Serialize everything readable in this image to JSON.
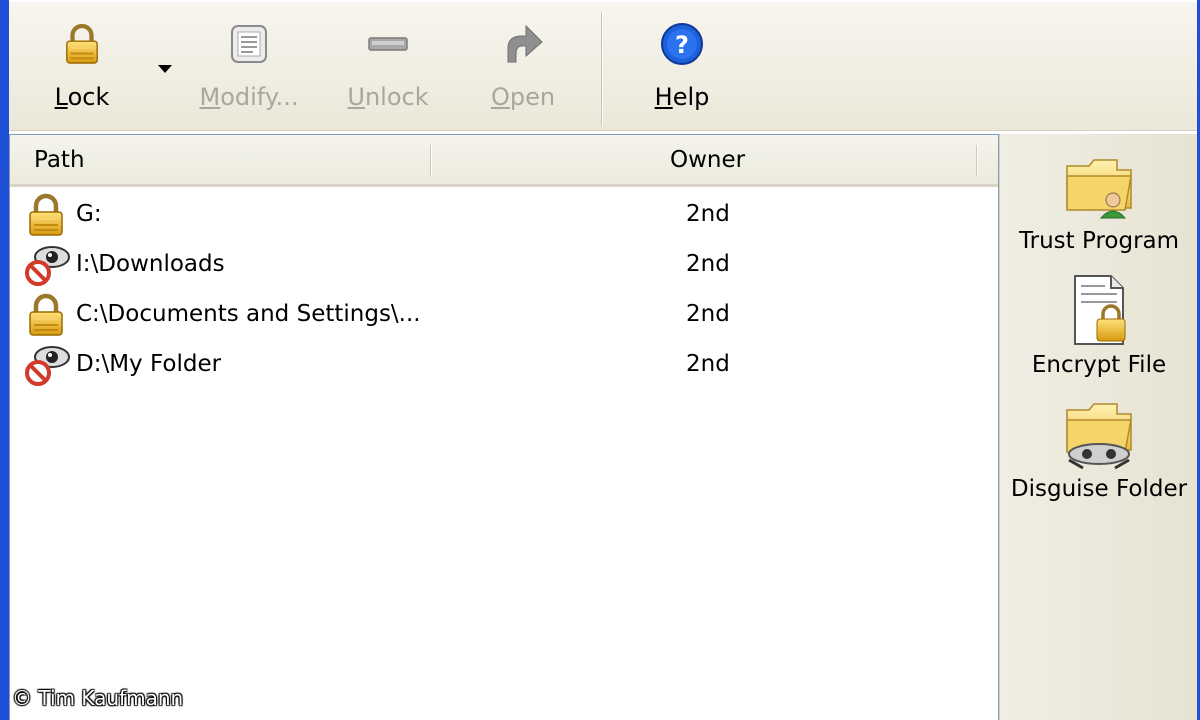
{
  "toolbar": {
    "lock": {
      "label_pre": "",
      "label_key": "L",
      "label_post": "ock",
      "icon": "padlock-icon"
    },
    "modify": {
      "label_pre": "",
      "label_key": "M",
      "label_post": "odify...",
      "icon": "document-icon"
    },
    "unlock": {
      "label_pre": "",
      "label_key": "U",
      "label_post": "nlock",
      "icon": "unlock-icon"
    },
    "open": {
      "label_pre": "",
      "label_key": "O",
      "label_post": "pen",
      "icon": "arrow-icon"
    },
    "help": {
      "label_pre": "",
      "label_key": "H",
      "label_post": "elp",
      "icon": "help-icon"
    }
  },
  "list": {
    "columns": {
      "path": "Path",
      "owner": "Owner"
    },
    "rows": [
      {
        "path": "G:",
        "owner": "2nd",
        "icon": "padlock-icon"
      },
      {
        "path": "I:\\Downloads",
        "owner": "2nd",
        "icon": "hidden-eye-icon"
      },
      {
        "path": "C:\\Documents and Settings\\...",
        "owner": "2nd",
        "icon": "padlock-icon"
      },
      {
        "path": "D:\\My Folder",
        "owner": "2nd",
        "icon": "hidden-eye-icon"
      }
    ]
  },
  "side": {
    "trust": "Trust Program",
    "encrypt": "Encrypt File",
    "disguise": "Disguise Folder"
  },
  "copyright": "© Tim Kaufmann",
  "colors": {
    "window_border": "#1f4fd6",
    "disabled_text": "#a8a6a0"
  }
}
